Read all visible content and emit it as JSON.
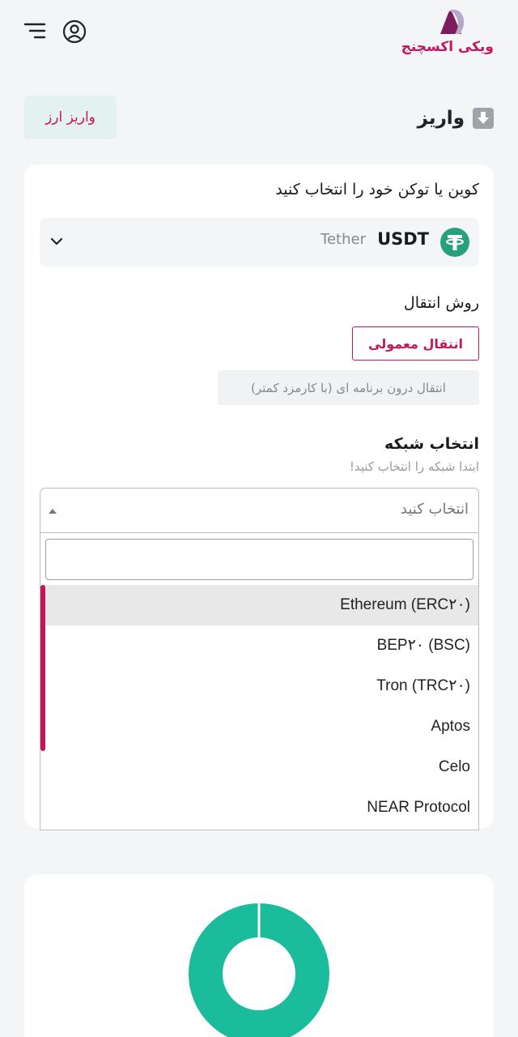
{
  "header": {
    "logo_text": "ویکی اکسچنج",
    "menu_icon": "menu-icon",
    "user_icon": "user-icon"
  },
  "page": {
    "title": "واریز",
    "title_icon": "download-icon",
    "deposit_crypto_button": "واریز ارز"
  },
  "form": {
    "coin_label": "کوین یا توکن خود را انتخاب کنید",
    "selected_coin": {
      "symbol": "USDT",
      "name": "Tether",
      "icon": "tether-icon"
    },
    "method_label": "روش انتقال",
    "methods": [
      {
        "label": "انتقال معمولی",
        "selected": true
      },
      {
        "label": "انتقال درون برنامه ای (با کارمزد کمتر)",
        "selected": false
      }
    ],
    "network_label": "انتخاب شبکه",
    "network_hint": "ابتدا شبکه را انتخاب کنید!",
    "network_placeholder": "انتخاب کنید",
    "network_search_value": "",
    "network_options": [
      "Ethereum (ERC۲۰)",
      "BEP۲۰ (BSC)",
      "Tron (TRC۲۰)",
      "Aptos",
      "Celo",
      "NEAR Protocol"
    ],
    "highlighted_option": "Ethereum (ERC۲۰)"
  },
  "colors": {
    "accent": "#c2185b",
    "teal": "#1abc9c",
    "background": "#f4f5f7"
  }
}
